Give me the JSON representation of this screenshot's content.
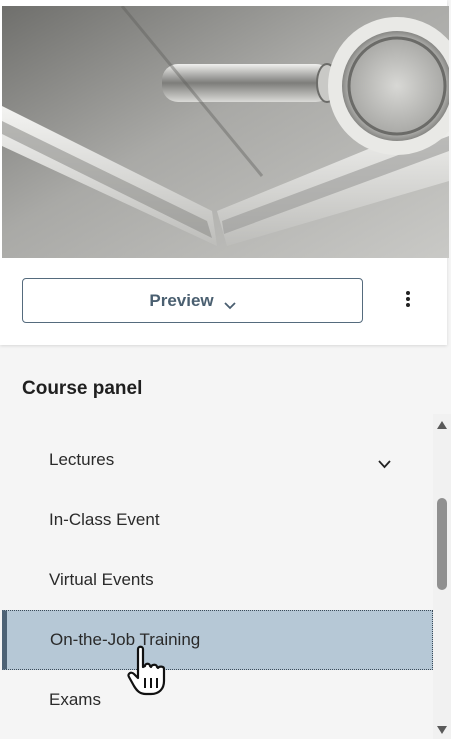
{
  "card": {
    "preview_label": "Preview",
    "preview_icon": "chevron-down-icon",
    "more_icon": "more-vertical-icon"
  },
  "panel": {
    "title": "Course panel",
    "items": [
      {
        "label": "Lectures",
        "has_chevron": true,
        "selected": false
      },
      {
        "label": "In-Class Event",
        "has_chevron": false,
        "selected": false
      },
      {
        "label": "Virtual Events",
        "has_chevron": false,
        "selected": false
      },
      {
        "label": "On-the-Job Training",
        "has_chevron": false,
        "selected": true
      },
      {
        "label": "Exams",
        "has_chevron": false,
        "selected": false
      }
    ]
  },
  "colors": {
    "accent": "#4d6275",
    "selected_bg": "#b6c8d6",
    "button_text": "#4a5f70"
  }
}
